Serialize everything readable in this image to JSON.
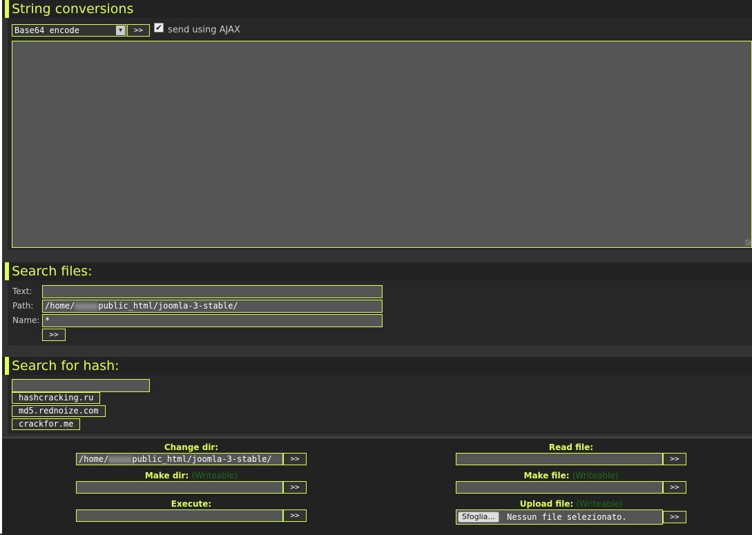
{
  "string_conversions": {
    "title": "String conversions",
    "select_value": "Base64 encode",
    "go_label": ">>",
    "ajax_checked": true,
    "ajax_label": "send using AJAX",
    "textarea_value": ""
  },
  "search_files": {
    "title": "Search files:",
    "text_label": "Text:",
    "text_value": "",
    "path_label": "Path:",
    "path_prefix": "/home/",
    "path_suffix": "public_html/joomla-3-stable/",
    "name_label": "Name:",
    "name_value": "*",
    "go_label": ">>"
  },
  "search_hash": {
    "title": "Search for hash:",
    "input_value": "",
    "services": [
      "hashcracking.ru",
      "md5.rednoize.com",
      "crackfor.me"
    ]
  },
  "bottom": {
    "change_dir": {
      "label": "Change dir:",
      "value_prefix": "/home/",
      "value_suffix": "public_html/joomla-3-stable/",
      "go": ">>"
    },
    "read_file": {
      "label": "Read file:",
      "value": "",
      "go": ">>"
    },
    "make_dir": {
      "label": "Make dir:",
      "status": "(Writeable)",
      "value": "",
      "go": ">>"
    },
    "make_file": {
      "label": "Make file:",
      "status": "(Writeable)",
      "value": "",
      "go": ">>"
    },
    "execute": {
      "label": "Execute:",
      "value": "",
      "go": ">>"
    },
    "upload_file": {
      "label": "Upload file:",
      "status": "(Writeable)",
      "browse": "Sfoglia...",
      "no_file": "Nessun file selezionato.",
      "go": ">>"
    }
  },
  "colors": {
    "accent": "#ddff55",
    "writeable": "#1a6e1a",
    "background": "#333333"
  }
}
